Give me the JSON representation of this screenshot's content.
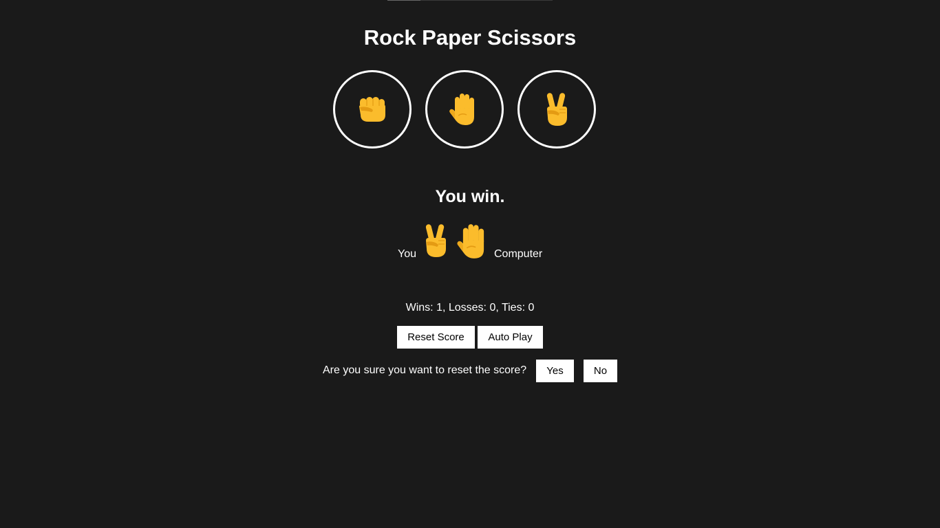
{
  "title": "Rock Paper Scissors",
  "moves": {
    "rock": {
      "icon": "fist-icon"
    },
    "paper": {
      "icon": "raised-hand-icon"
    },
    "scissors": {
      "icon": "victory-hand-icon"
    }
  },
  "result": "You win.",
  "played": {
    "you_label": "You",
    "you_move": "scissors",
    "computer_move": "paper",
    "computer_label": "Computer"
  },
  "score_text": "Wins: 1, Losses: 0, Ties: 0",
  "buttons": {
    "reset": "Reset Score",
    "auto_play": "Auto Play"
  },
  "confirm": {
    "question": "Are you sure you want to reset the score?",
    "yes": "Yes",
    "no": "No"
  },
  "colors": {
    "background": "#1a1a1a",
    "emoji_yellow": "#fbbc2c",
    "emoji_shade": "#e49b13"
  }
}
